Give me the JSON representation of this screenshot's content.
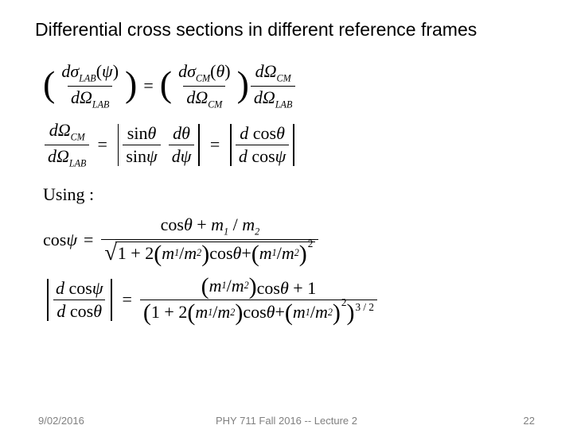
{
  "title": "Differential cross sections in different reference frames",
  "eq": {
    "dsigma": "dσ",
    "dOmega": "dΩ",
    "lab": "LAB",
    "cm": "CM",
    "psi": "ψ",
    "theta": "θ",
    "sin": "sin",
    "cos": "cos",
    "using": "Using :",
    "d": "d",
    "m1": "m",
    "m2": "m",
    "sub1": "1",
    "sub2": "2",
    "plus": " + ",
    "slash": " / ",
    "one": "1",
    "two": "2",
    "threehalf": "3 / 2",
    "plus2cos": "1 + 2"
  },
  "footer": {
    "date": "9/02/2016",
    "course": "PHY 711  Fall 2016 -- Lecture 2",
    "page": "22"
  }
}
